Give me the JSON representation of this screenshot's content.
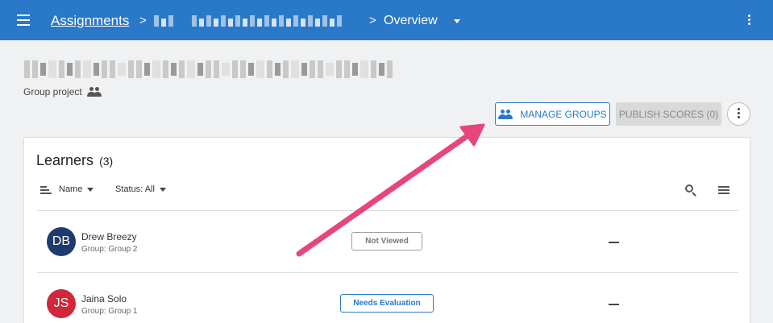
{
  "topbar": {
    "breadcrumb_root": "Assignments",
    "breadcrumb_chevron": ">",
    "breadcrumb_current": "Overview",
    "color": "#2a78c8"
  },
  "page": {
    "group_project_label": "Group project"
  },
  "actions": {
    "manage_groups_label": "MANAGE GROUPS",
    "publish_scores_label": "PUBLISH SCORES (0)"
  },
  "learners": {
    "title": "Learners",
    "count": "(3)",
    "sort_label": "Name",
    "status_filter_label": "Status: All",
    "rows": [
      {
        "initials": "DB",
        "name": "Drew Breezy",
        "group": "Group: Group 2",
        "status": "Not Viewed",
        "score": "—",
        "avatar_color": "#1f3a6e"
      },
      {
        "initials": "JS",
        "name": "Jaina Solo",
        "group": "Group: Group 1",
        "status": "Needs Evaluation",
        "score": "—",
        "avatar_color": "#d0273a"
      }
    ]
  },
  "colors": {
    "accent": "#2a78c8",
    "annotation_arrow": "#e8457c"
  }
}
